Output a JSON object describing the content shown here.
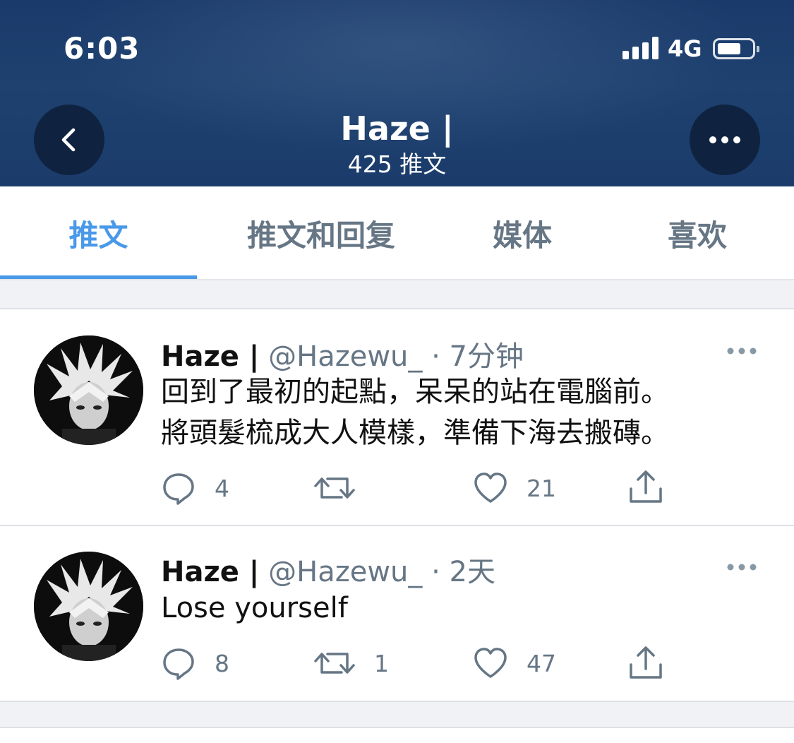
{
  "status_bar": {
    "time": "6:03",
    "network": "4G"
  },
  "header": {
    "name": "Haze |",
    "tweet_count": "425 推文"
  },
  "tabs": [
    {
      "label": "推文",
      "active": true
    },
    {
      "label": "推文和回复",
      "active": false
    },
    {
      "label": "媒体",
      "active": false
    },
    {
      "label": "喜欢",
      "active": false
    }
  ],
  "tweets": [
    {
      "name": "Haze |",
      "handle": "@Hazewu_",
      "time": "· 7分钟",
      "lines": [
        "回到了最初的起點，呆呆的站在電腦前。",
        "將頭髮梳成大人模樣，準備下海去搬磚。"
      ],
      "replies": "4",
      "retweets": "",
      "likes": "21"
    },
    {
      "name": "Haze |",
      "handle": "@Hazewu_",
      "time": "· 2天",
      "lines": [
        "Lose yourself"
      ],
      "replies": "8",
      "retweets": "1",
      "likes": "47"
    }
  ],
  "colors": {
    "header_bg": "#1a3a6b",
    "accent": "#4a99e9",
    "muted": "#667685"
  },
  "icons": [
    "back-arrow-icon",
    "more-horizontal-icon",
    "signal-icon",
    "battery-icon",
    "reply-icon",
    "retweet-icon",
    "like-icon",
    "share-icon"
  ]
}
